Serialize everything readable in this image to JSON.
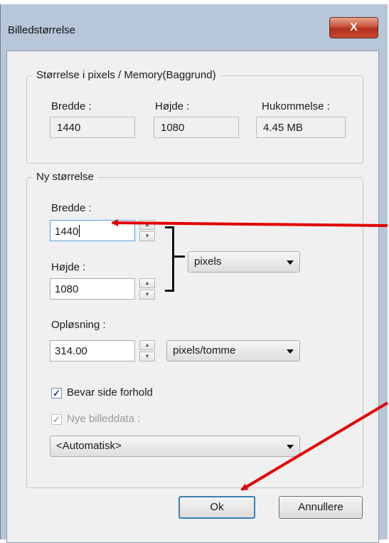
{
  "window": {
    "title": "Billedstørrelse",
    "close_glyph": "X"
  },
  "current_size": {
    "group_title": "Størrelse i pixels / Memory(Baggrund)",
    "width_label": "Bredde :",
    "width_value": "1440",
    "height_label": "Højde :",
    "height_value": "1080",
    "memory_label": "Hukommelse :",
    "memory_value": "4.45 MB"
  },
  "new_size": {
    "group_title": "Ny størrelse",
    "width_label": "Bredde :",
    "width_value": "1440",
    "height_label": "Højde :",
    "height_value": "1080",
    "unit_select": "pixels",
    "resolution_label": "Opløsning :",
    "resolution_value": "314.00",
    "resolution_unit_select": "pixels/tomme",
    "keep_aspect_label": "Bevar side forhold",
    "keep_aspect_checked": true,
    "new_image_data_label": "Nye billeddata :",
    "new_image_data_checked": true,
    "new_image_data_disabled": true,
    "resample_select": "<Automatisk>"
  },
  "buttons": {
    "ok": "Ok",
    "cancel": "Annullere"
  },
  "colors": {
    "annotation_arrow": "#e30000",
    "focus_border": "#569de5",
    "close_button": "#c8503a"
  },
  "icons": [
    "close-icon",
    "spin-up-icon",
    "spin-down-icon",
    "dropdown-arrow-icon",
    "checkmark-icon"
  ]
}
